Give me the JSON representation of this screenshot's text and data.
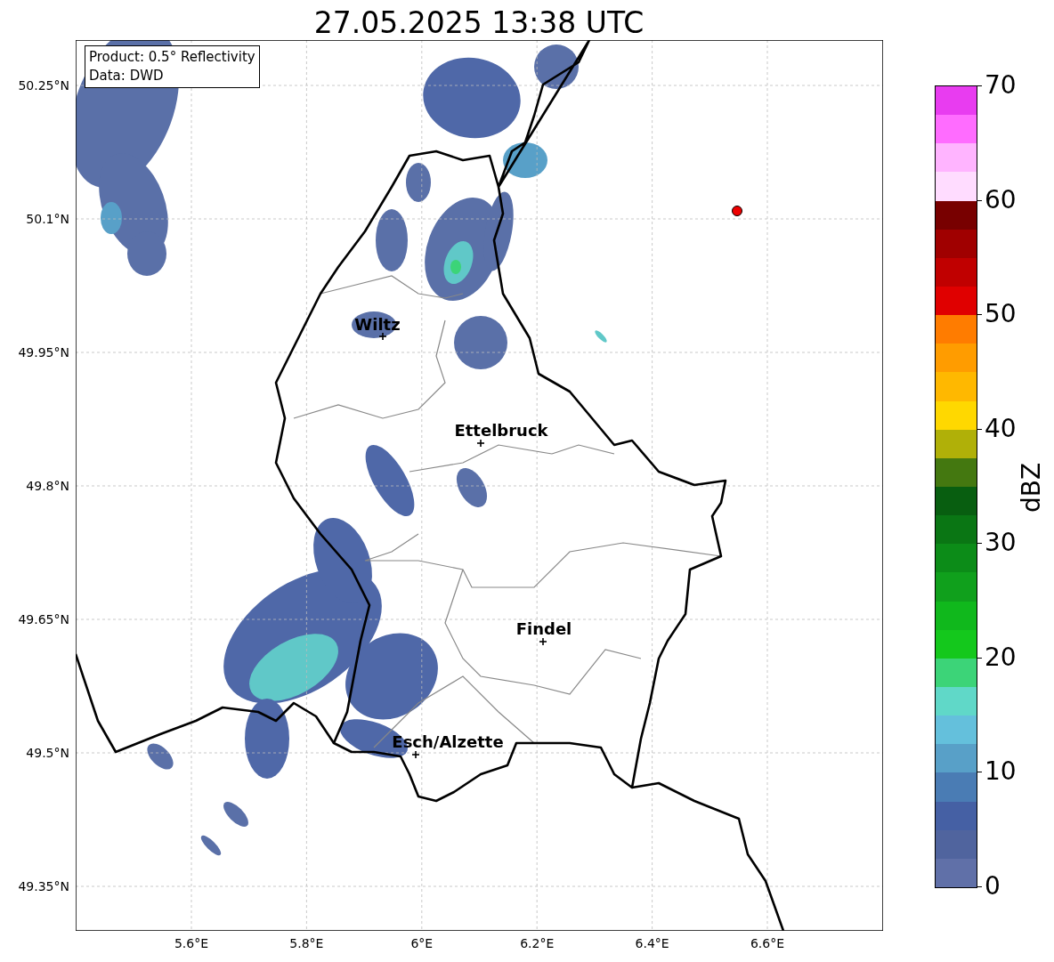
{
  "title": "27.05.2025 13:38 UTC",
  "info_box": [
    "Product: 0.5° Reflectivity",
    "Data: DWD"
  ],
  "x_ticks": [
    "5.6°E",
    "5.8°E",
    "6°E",
    "6.2°E",
    "6.4°E",
    "6.6°E"
  ],
  "y_ticks": [
    "50.25°N",
    "50.1°N",
    "49.95°N",
    "49.8°N",
    "49.65°N",
    "49.5°N",
    "49.35°N"
  ],
  "cities": [
    {
      "name": "Wiltz"
    },
    {
      "name": "Ettelbruck"
    },
    {
      "name": "Findel"
    },
    {
      "name": "Esch/Alzette"
    }
  ],
  "colorbar": {
    "label": "dBZ",
    "ticks": [
      "70",
      "60",
      "50",
      "40",
      "30",
      "20",
      "10",
      "0"
    ],
    "bands": [
      {
        "color": "#6070a8"
      },
      {
        "color": "#50649e"
      },
      {
        "color": "#4560a4"
      },
      {
        "color": "#4a7cb4"
      },
      {
        "color": "#58a0c8"
      },
      {
        "color": "#64c0dc"
      },
      {
        "color": "#60d8c8"
      },
      {
        "color": "#3cd478"
      },
      {
        "color": "#14c81c"
      },
      {
        "color": "#10b81c"
      },
      {
        "color": "#10a01c"
      },
      {
        "color": "#0c8c18"
      },
      {
        "color": "#0a7614"
      },
      {
        "color": "#085e10"
      },
      {
        "color": "#447810"
      },
      {
        "color": "#b0b008"
      },
      {
        "color": "#ffd800"
      },
      {
        "color": "#ffb800"
      },
      {
        "color": "#ff9c00"
      },
      {
        "color": "#ff7c00"
      },
      {
        "color": "#e00000"
      },
      {
        "color": "#c00000"
      },
      {
        "color": "#a00000"
      },
      {
        "color": "#780000"
      },
      {
        "color": "#ffdcff"
      },
      {
        "color": "#ffb4ff"
      },
      {
        "color": "#ff6cff"
      },
      {
        "color": "#e83cf0"
      }
    ]
  }
}
